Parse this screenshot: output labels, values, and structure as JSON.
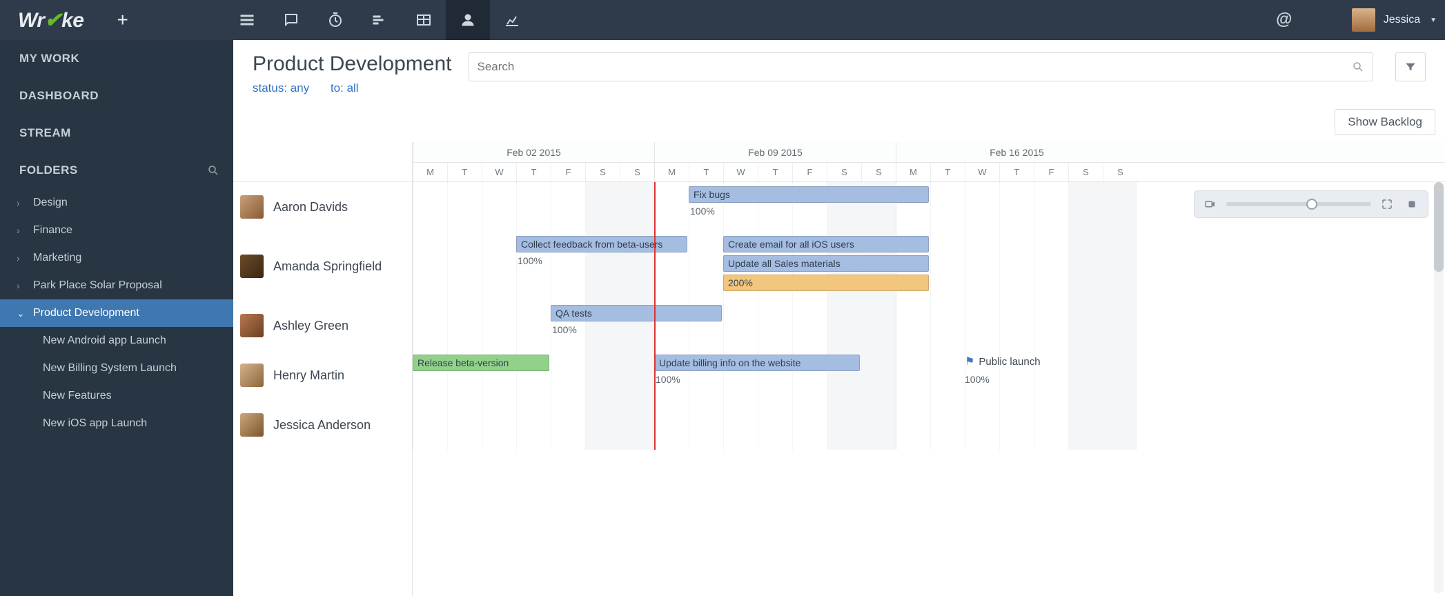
{
  "brand": "Wrike",
  "user": {
    "name": "Jessica"
  },
  "sidebar": {
    "my_work": "MY WORK",
    "dashboard": "DASHBOARD",
    "stream": "STREAM",
    "folders_label": "FOLDERS",
    "folders": [
      {
        "label": "Design"
      },
      {
        "label": "Finance"
      },
      {
        "label": "Marketing"
      },
      {
        "label": "Park Place Solar Proposal"
      },
      {
        "label": "Product Development",
        "selected": true,
        "children": [
          {
            "label": "New Android app Launch"
          },
          {
            "label": "New Billing System Launch"
          },
          {
            "label": "New Features"
          },
          {
            "label": "New iOS app Launch"
          }
        ]
      }
    ]
  },
  "page": {
    "title": "Product Development",
    "status_filter": "status: any",
    "to_filter": "to: all",
    "search_placeholder": "Search",
    "show_backlog": "Show Backlog"
  },
  "timeline": {
    "day_labels": [
      "M",
      "T",
      "W",
      "T",
      "F",
      "S",
      "S"
    ],
    "first_day_index": 0,
    "weeks": [
      {
        "label": "Feb 02 2015"
      },
      {
        "label": "Feb 09 2015"
      },
      {
        "label": "Feb 16 2015"
      }
    ],
    "today_index": 7,
    "people": [
      {
        "name": "Aaron Davids",
        "height": "short"
      },
      {
        "name": "Amanda Springfield",
        "height": "tall"
      },
      {
        "name": "Ashley Green",
        "height": "short"
      },
      {
        "name": "Henry Martin",
        "height": "short"
      },
      {
        "name": "Jessica Anderson",
        "height": "short"
      }
    ],
    "bars": [
      {
        "row": 0,
        "start": 8,
        "span": 7,
        "color": "blue",
        "label": "Fix bugs",
        "pct": "100%",
        "pct_offset": 8
      },
      {
        "row": 1,
        "start": 3,
        "span": 5,
        "color": "blue",
        "label": "Collect feedback from beta-users",
        "pct": "100%",
        "pct_offset": 3
      },
      {
        "row": 1,
        "start": 9,
        "span": 6,
        "color": "blue",
        "label": "Create email for all iOS users",
        "y": 0
      },
      {
        "row": 1,
        "start": 9,
        "span": 6,
        "color": "blue",
        "label": "Update all Sales materials",
        "y": 1
      },
      {
        "row": 1,
        "start": 9,
        "span": 6,
        "color": "orange",
        "label": "200%",
        "y": 2
      },
      {
        "row": 2,
        "start": 4,
        "span": 5,
        "color": "blue",
        "label": "QA tests",
        "pct": "100%",
        "pct_offset": 4
      },
      {
        "row": 3,
        "start": 0,
        "span": 4,
        "color": "green",
        "label": "Release beta-version"
      },
      {
        "row": 3,
        "start": 7,
        "span": 6,
        "color": "blue",
        "label": "Update billing info on the website",
        "pct": "100%",
        "pct_offset": 7
      }
    ],
    "milestones": [
      {
        "row": 3,
        "at": 16,
        "label": "Public launch",
        "pct": "100%"
      }
    ]
  }
}
